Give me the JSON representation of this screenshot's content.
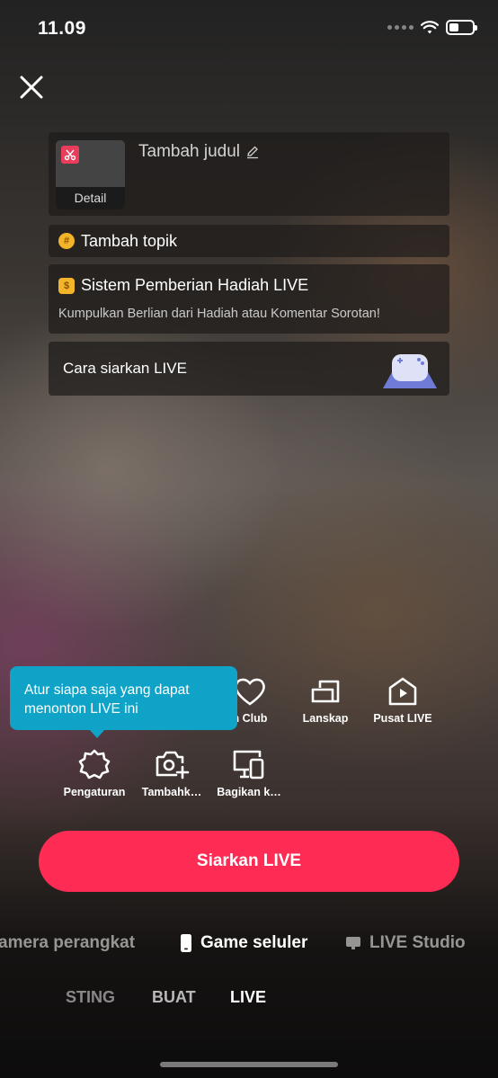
{
  "status_bar": {
    "time": "11.09"
  },
  "title_card": {
    "thumbnail_label": "Detail",
    "title_placeholder": "Tambah judul"
  },
  "topic": {
    "label": "Tambah topik"
  },
  "gift_system": {
    "title": "Sistem Pemberian Hadiah LIVE",
    "subtitle": "Kumpulkan Berlian dari Hadiah atau Komentar Sorotan!"
  },
  "tutorial": {
    "label": "Cara siarkan LIVE"
  },
  "tooltip": {
    "text": "Atur siapa saja yang dapat menonton LIVE ini"
  },
  "tools": {
    "fan_club": "n Club",
    "landscape": "Lanskap",
    "live_center": "Pusat LIVE",
    "settings": "Pengaturan",
    "add": "Tambahk…",
    "share": "Bagikan k…"
  },
  "go_live_button": "Siarkan LIVE",
  "modes": {
    "device_camera": "amera perangkat",
    "mobile_game": "Game seluler",
    "live_studio": "LIVE Studio"
  },
  "bottom_tabs": {
    "posting": "STING",
    "create": "BUAT",
    "live": "LIVE"
  },
  "colors": {
    "accent": "#fe2c55",
    "tooltip": "#0ea3c7",
    "topic_badge": "#f3b42a"
  }
}
